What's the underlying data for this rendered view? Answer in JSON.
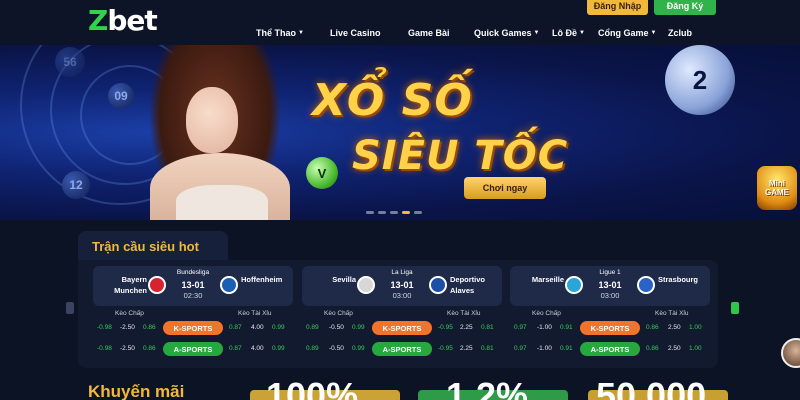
{
  "header": {
    "logo": "Zbet",
    "login_label": "Đăng Nhập",
    "register_label": "Đăng Ký",
    "nav": [
      {
        "label": "Thể Thao",
        "dropdown": true
      },
      {
        "label": "Live Casino",
        "dropdown": false
      },
      {
        "label": "Game Bài",
        "dropdown": false
      },
      {
        "label": "Quick Games",
        "dropdown": true
      },
      {
        "label": "Lô Đề",
        "dropdown": true
      },
      {
        "label": "Cổng Game",
        "dropdown": true
      },
      {
        "label": "Zclub",
        "dropdown": false
      }
    ]
  },
  "banner": {
    "title_line1": "XỔ SỐ",
    "title_line2": "SIÊU TỐC",
    "cta": "Chơi ngay",
    "balls": [
      "56",
      "09",
      "12",
      "2",
      "V"
    ],
    "slide_active": 3,
    "slide_count": 5
  },
  "mini_game": {
    "line1": "Mini",
    "line2": "GAME"
  },
  "hot_matches": {
    "title": "Trận cầu siêu hot",
    "handicap_label": "Kèo Chấp",
    "overunder_label": "Kèo Tài Xỉu",
    "k_sports": "K-SPORTS",
    "a_sports": "A-SPORTS",
    "matches": [
      {
        "home": "Bayern Munchen",
        "away": "Hoffenheim",
        "league": "Bundesliga",
        "date": "13-01",
        "time": "02:30",
        "home_color": "#d6232f",
        "away_color": "#1a5fb4",
        "k": {
          "h1": "-0.98",
          "h2": "-2.50",
          "h3": "0.86",
          "o1": "0.87",
          "o2": "4.00",
          "o3": "0.99"
        },
        "a": {
          "h1": "-0.98",
          "h2": "-2.50",
          "h3": "0.86",
          "o1": "0.87",
          "o2": "4.00",
          "o3": "0.99"
        }
      },
      {
        "home": "Sevilla",
        "away": "Deportivo Alaves",
        "league": "La Liga",
        "date": "13-01",
        "time": "03:00",
        "home_color": "#d7d7d7",
        "away_color": "#1c4fa8",
        "k": {
          "h1": "0.89",
          "h2": "-0.50",
          "h3": "0.99",
          "o1": "-0.95",
          "o2": "2.25",
          "o3": "0.81"
        },
        "a": {
          "h1": "0.89",
          "h2": "-0.50",
          "h3": "0.99",
          "o1": "-0.95",
          "o2": "2.25",
          "o3": "0.81"
        }
      },
      {
        "home": "Marseille",
        "away": "Strasbourg",
        "league": "Ligue 1",
        "date": "13-01",
        "time": "03:00",
        "home_color": "#2aa5d8",
        "away_color": "#2a62c9",
        "k": {
          "h1": "0.97",
          "h2": "-1.00",
          "h3": "0.91",
          "o1": "0.86",
          "o2": "2.50",
          "o3": "1.00"
        },
        "a": {
          "h1": "0.97",
          "h2": "-1.00",
          "h3": "0.91",
          "o1": "0.86",
          "o2": "2.50",
          "o3": "1.00"
        }
      }
    ]
  },
  "promo": {
    "title": "Khuyến mãi",
    "values": [
      "100%",
      "1,2%",
      "50.000"
    ]
  }
}
